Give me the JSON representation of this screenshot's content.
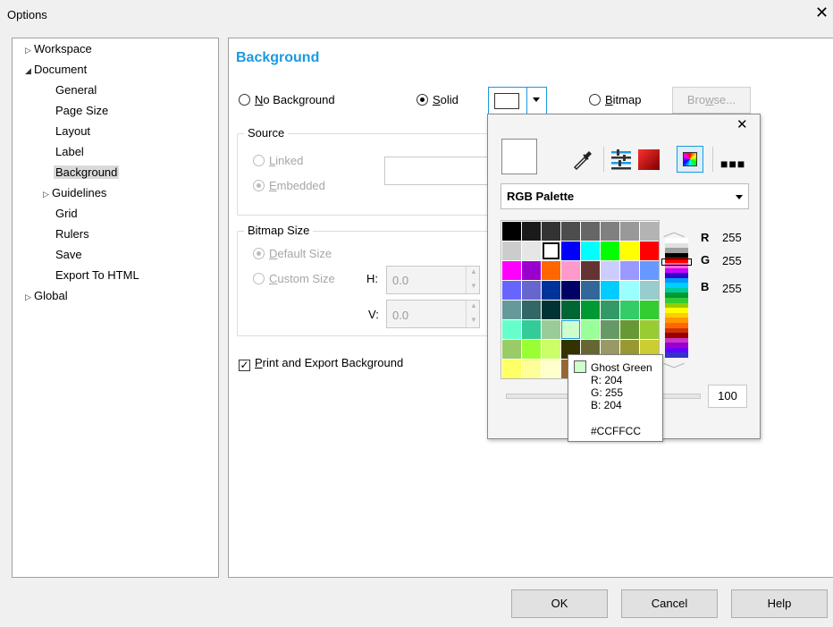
{
  "window": {
    "title": "Options",
    "close_glyph": "✕"
  },
  "tree": {
    "items": [
      {
        "label": "Workspace",
        "arrow": "▷"
      },
      {
        "label": "Document",
        "arrow": "◢"
      },
      {
        "label": "General"
      },
      {
        "label": "Page Size"
      },
      {
        "label": "Layout"
      },
      {
        "label": "Label"
      },
      {
        "label": "Background",
        "selected": true
      },
      {
        "label": "Guidelines",
        "arrow": "▷"
      },
      {
        "label": "Grid"
      },
      {
        "label": "Rulers"
      },
      {
        "label": "Save"
      },
      {
        "label": "Export To HTML"
      },
      {
        "label": "Global",
        "arrow": "▷"
      }
    ]
  },
  "background": {
    "title": "Background",
    "no_background": {
      "accel": "N",
      "rest": "o Background"
    },
    "solid": {
      "accel": "S",
      "rest": "olid"
    },
    "bitmap": {
      "accel": "B",
      "rest": "itmap"
    },
    "browse": {
      "pre": "Bro",
      "accel": "w",
      "post": "se..."
    },
    "source": {
      "legend": "Source",
      "linked": {
        "accel": "L",
        "rest": "inked"
      },
      "embedded": {
        "accel": "E",
        "rest": "mbedded"
      }
    },
    "bitmap_size": {
      "legend": "Bitmap Size",
      "default_size": {
        "accel": "D",
        "rest": "efault Size"
      },
      "custom_size": {
        "accel": "C",
        "rest": "ustom Size"
      },
      "h_label": "H:",
      "h_value": "0.0",
      "v_label": "V:",
      "v_value": "0.0"
    },
    "print_export": {
      "accel": "P",
      "rest": "rint and Export Background",
      "checked": true
    }
  },
  "color_popup": {
    "close_glyph": "✕",
    "palette_name": "RGB Palette",
    "r_label": "R",
    "r_value": "255",
    "g_label": "G",
    "g_value": "255",
    "b_label": "B",
    "b_value": "255",
    "opacity_value": "100",
    "swatches": [
      [
        "#000000",
        "#1a1a1a",
        "#333333",
        "#4d4d4d",
        "#666666",
        "#808080",
        "#999999",
        "#b3b3b3"
      ],
      [
        "#cccccc",
        "#e6e6e6",
        "#ffffff",
        "#0000ff",
        "#00ffff",
        "#00ff00",
        "#ffff00",
        "#ff0000"
      ],
      [
        "#ff00ff",
        "#9900cc",
        "#ff6600",
        "#ff99cc",
        "#663333",
        "#ccccff",
        "#9999ff",
        "#6699ff"
      ],
      [
        "#6666ff",
        "#6666cc",
        "#003399",
        "#000066",
        "#336699",
        "#00ccff",
        "#99ffff",
        "#99cccc"
      ],
      [
        "#669999",
        "#336666",
        "#003333",
        "#006633",
        "#009933",
        "#339966",
        "#33cc66",
        "#33cc33"
      ],
      [
        "#66ffcc",
        "#33cc99",
        "#99cc99",
        "#ccffcc",
        "#99ff99",
        "#669966",
        "#669933",
        "#99cc33"
      ],
      [
        "#99cc66",
        "#99ff33",
        "#ccff66",
        "#333300",
        "#666633",
        "#999966",
        "#999933",
        "#cccc33"
      ],
      [
        "#ffff66",
        "#ffff99",
        "#ffffcc",
        "#996633",
        "#999966",
        "#cccc66",
        "#cccc99",
        "#ffcc66"
      ]
    ],
    "spectrum_colors": [
      "#ffffff",
      "#e0e0e0",
      "#a0a0a0",
      "#000000",
      "#ff0000",
      "#ff66cc",
      "#cc00ff",
      "#3300cc",
      "#0099ff",
      "#00ccff",
      "#00cc99",
      "#009933",
      "#33cc33",
      "#99cc00",
      "#ffff00",
      "#ffcc00",
      "#ff9900",
      "#ff6600",
      "#cc3300",
      "#990000",
      "#cc33cc",
      "#9900cc",
      "#6600ff",
      "#3333cc"
    ]
  },
  "tooltip": {
    "name": "Ghost Green",
    "r": "R: 204",
    "g": "G: 255",
    "b": "B: 204",
    "hex": "#CCFFCC",
    "color": "#ccffcc"
  },
  "buttons": {
    "ok": "OK",
    "cancel": "Cancel",
    "help": "Help"
  }
}
